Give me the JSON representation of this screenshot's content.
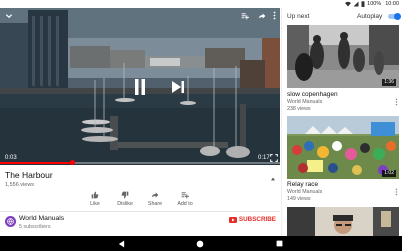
{
  "status_bar": {
    "battery": "100%",
    "time": "10:00",
    "icons": [
      "wifi-icon",
      "signal-icon",
      "battery-icon"
    ]
  },
  "player": {
    "current_time": "0:03",
    "duration": "0:17",
    "progress_percent": 26,
    "top_icons": [
      "chevron-down-icon",
      "add-to-playlist-icon",
      "share-icon",
      "more-vert-icon"
    ],
    "center_icons": [
      "pause-icon",
      "skip-next-icon"
    ],
    "bottom_icon": "fullscreen-icon"
  },
  "video": {
    "title": "The Harbour",
    "views": "1,556 views"
  },
  "actions": [
    {
      "icon": "thumb-up-icon",
      "label": "Like"
    },
    {
      "icon": "thumb-down-icon",
      "label": "Dislike"
    },
    {
      "icon": "share-icon",
      "label": "Share"
    },
    {
      "icon": "add-to-icon",
      "label": "Add to"
    }
  ],
  "channel": {
    "name": "World Manuals",
    "subscribers": "5 subscribers",
    "subscribe_label": "SUBSCRIBE",
    "subscribe_color": "#e52d27"
  },
  "up_next": {
    "heading": "Up next",
    "autoplay_label": "Autoplay",
    "autoplay_on": true,
    "videos": [
      {
        "title": "slow copenhagen",
        "channel": "World Manuals",
        "views": "238 views",
        "duration": "1:36"
      },
      {
        "title": "Relay race",
        "channel": "World Manuals",
        "views": "149 views",
        "duration": "1:02"
      },
      {
        "title": "",
        "channel": "",
        "views": "",
        "duration": ""
      }
    ]
  },
  "nav_bar": {
    "icons": [
      "back-icon",
      "home-icon",
      "recents-icon"
    ]
  },
  "colors": {
    "accent_red": "#ff0000",
    "toggle_blue": "#1a73e8",
    "avatar_purple": "#7b3fbf"
  }
}
